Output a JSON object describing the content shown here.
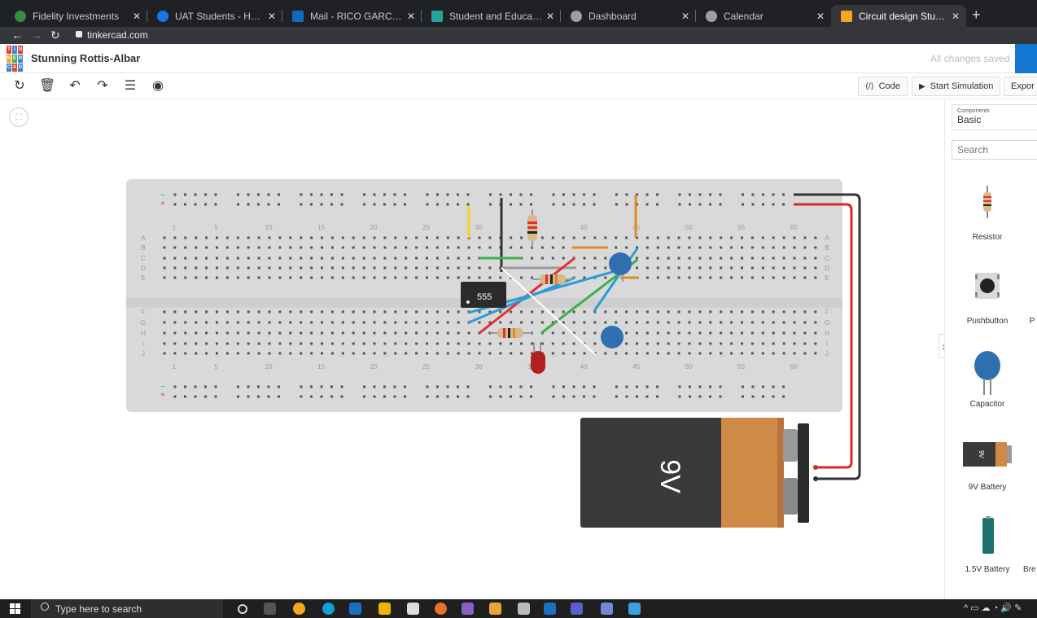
{
  "browser": {
    "tabs": [
      {
        "label": "Fidelity Investments",
        "fav_color": "#3b8a3e",
        "active": false
      },
      {
        "label": "UAT Students - Home",
        "fav_color": "#1a73e8",
        "active": false
      },
      {
        "label": "Mail - RICO GARCIA - Outlook",
        "fav_color": "#0f6cbd",
        "active": false
      },
      {
        "label": "Student and Education Software",
        "fav_color": "#26a69a",
        "active": false
      },
      {
        "label": "Dashboard",
        "fav_color": "#9e9e9e",
        "active": false
      },
      {
        "label": "Calendar",
        "fav_color": "#9e9e9e",
        "active": false
      },
      {
        "label": "Circuit design Stunning Rottis-Alb",
        "fav_color": "#f5a623",
        "active": true
      }
    ],
    "url": "tinkercad.com"
  },
  "app": {
    "logo_letters": [
      "T",
      "I",
      "N",
      "K",
      "E",
      "R",
      "C",
      "A",
      "D"
    ],
    "project_title": "Stunning Rottis-Albar",
    "save_status": "All changes saved"
  },
  "toolbar": {
    "code_label": "Code",
    "simulate_label": "Start Simulation",
    "export_label": "Expor"
  },
  "breadboard": {
    "top_numbers": [
      "1",
      "5",
      "10",
      "15",
      "20",
      "25",
      "30",
      "35",
      "40",
      "45",
      "50",
      "55",
      "60"
    ],
    "row_letters_top": [
      "A",
      "B",
      "C",
      "D",
      "E"
    ],
    "row_letters_bottom": [
      "F",
      "G",
      "H",
      "I",
      "J"
    ],
    "chip_label": "555",
    "battery_label": "9V"
  },
  "panel": {
    "components_small": "Components",
    "components_value": "Basic",
    "search_placeholder": "Search",
    "items": [
      {
        "label": "Resistor"
      },
      {
        "label": "Pushbutton"
      },
      {
        "label": "Capacitor"
      },
      {
        "label": "9V Battery"
      },
      {
        "label": "1.5V Battery"
      },
      {
        "label": "Bre"
      }
    ],
    "partial_letters": [
      "P"
    ]
  },
  "taskbar": {
    "search_placeholder": "Type here to search"
  }
}
